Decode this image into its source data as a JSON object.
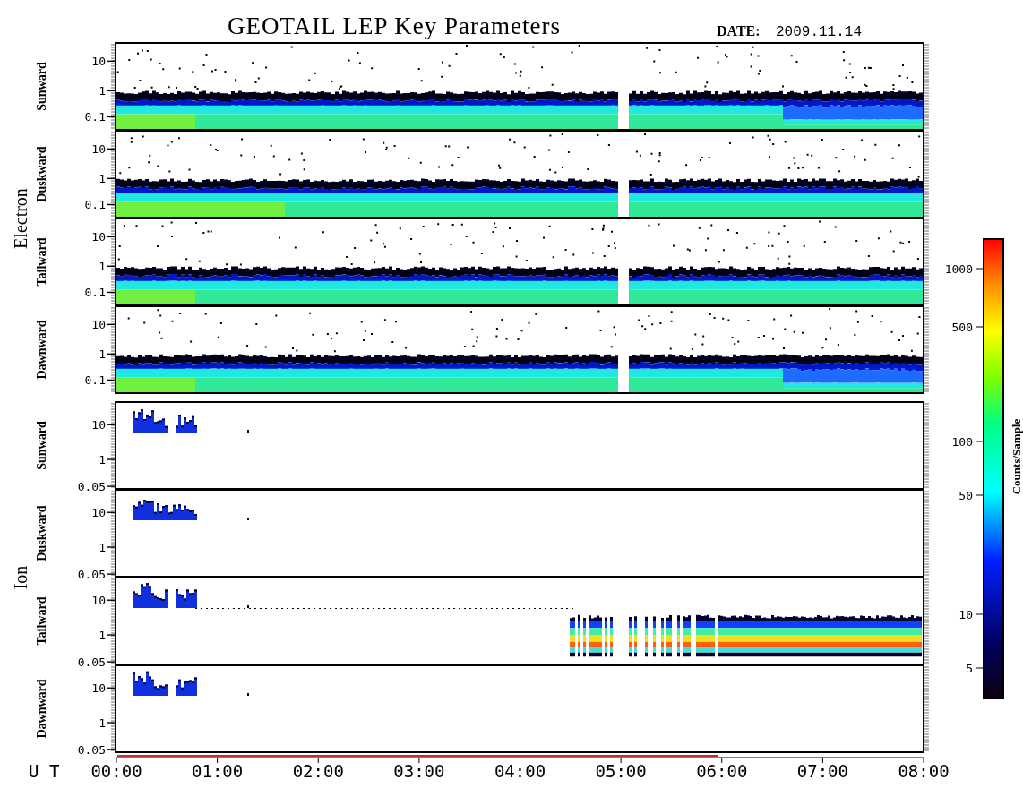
{
  "title": "GEOTAIL LEP Key Parameters",
  "date": {
    "label": "DATE:",
    "value": "2009.11.14"
  },
  "groups": [
    {
      "name": "Electron",
      "kind": "electron",
      "panels": [
        {
          "direction": "Sunward",
          "kind": "band",
          "yticks": [
            "10",
            "1",
            "0.1"
          ]
        },
        {
          "direction": "Duskward",
          "kind": "band",
          "yticks": [
            "10",
            "1",
            "0.1"
          ]
        },
        {
          "direction": "Tailward",
          "kind": "band",
          "yticks": [
            "10",
            "1",
            "0.1"
          ]
        },
        {
          "direction": "Dawnward",
          "kind": "band",
          "yticks": [
            "10",
            "1",
            "0.1"
          ]
        }
      ]
    },
    {
      "name": "Ion",
      "kind": "ion",
      "panels": [
        {
          "direction": "Sunward",
          "kind": "burst",
          "yticks": [
            "10",
            "1",
            "0.05"
          ]
        },
        {
          "direction": "Duskward",
          "kind": "burst",
          "yticks": [
            "10",
            "1",
            "0.05"
          ]
        },
        {
          "direction": "Tailward",
          "kind": "burst-and-band",
          "yticks": [
            "10",
            "1",
            "0.05"
          ]
        },
        {
          "direction": "Dawnward",
          "kind": "burst",
          "yticks": [
            "10",
            "1",
            "0.05"
          ]
        }
      ]
    }
  ],
  "x_axis": {
    "label": "U T",
    "ticks": [
      "00:00",
      "01:00",
      "02:00",
      "03:00",
      "04:00",
      "05:00",
      "06:00",
      "07:00",
      "08:00"
    ]
  },
  "colorbar": {
    "label": "Counts/Sample",
    "ticks": [
      "1000",
      "500",
      "100",
      "50",
      "10",
      "5"
    ]
  }
}
